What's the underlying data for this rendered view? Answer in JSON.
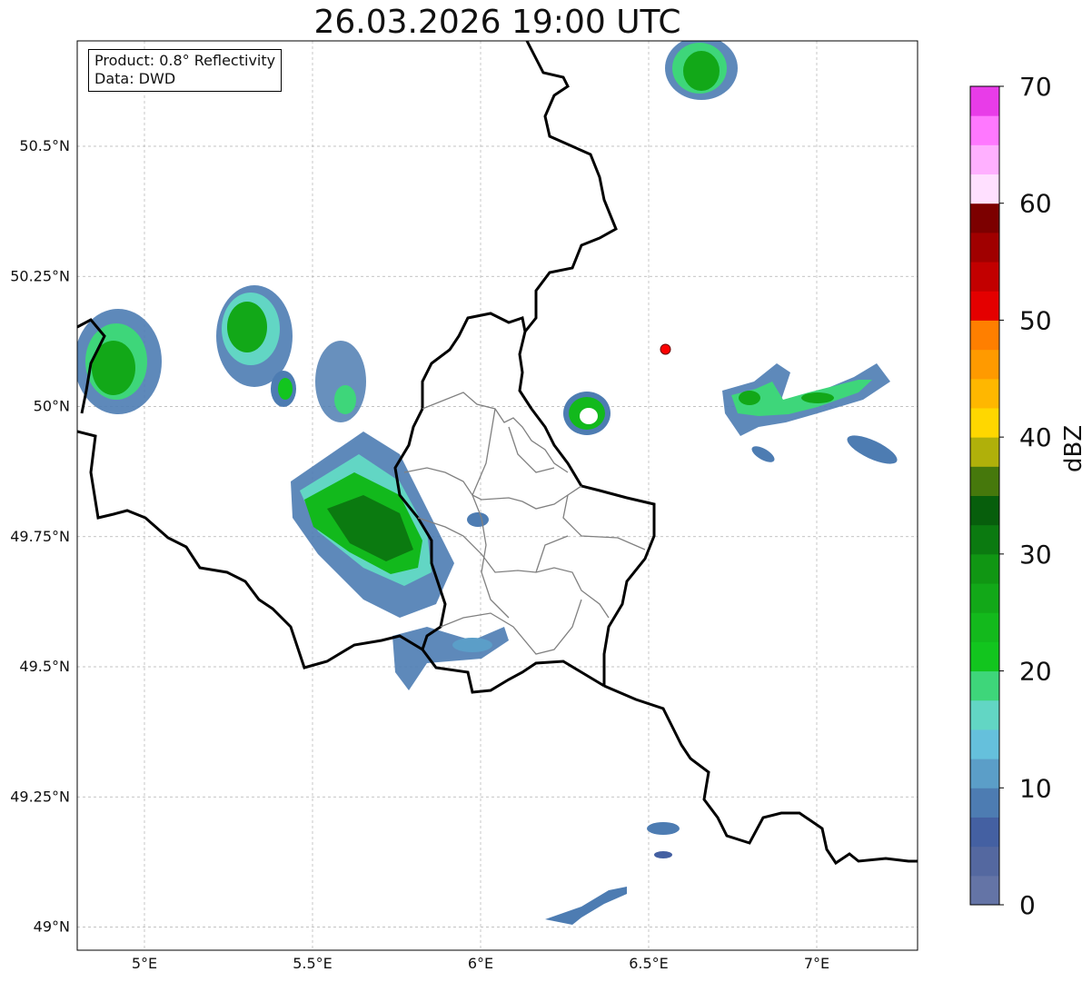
{
  "title": "26.03.2026 19:00 UTC",
  "info": {
    "product": "Product: 0.8° Reflectivity",
    "source": "Data: DWD"
  },
  "map": {
    "lon_range": [
      4.8,
      7.3
    ],
    "lat_range": [
      48.95,
      50.7
    ],
    "lat_ticks": [
      {
        "value": 50.5,
        "label": "50.5°N"
      },
      {
        "value": 50.25,
        "label": "50.25°N"
      },
      {
        "value": 50.0,
        "label": "50°N"
      },
      {
        "value": 49.75,
        "label": "49.75°N"
      },
      {
        "value": 49.5,
        "label": "49.5°N"
      },
      {
        "value": 49.25,
        "label": "49.25°N"
      },
      {
        "value": 49.0,
        "label": "49°N"
      }
    ],
    "lon_ticks": [
      {
        "value": 5.0,
        "label": "5°E"
      },
      {
        "value": 5.5,
        "label": "5.5°E"
      },
      {
        "value": 6.0,
        "label": "6°E"
      },
      {
        "value": 6.5,
        "label": "6.5°E"
      },
      {
        "value": 7.0,
        "label": "7°E"
      }
    ],
    "radar_site": {
      "lon": 6.55,
      "lat": 50.11,
      "color": "#ff0000"
    },
    "grid": true
  },
  "colorbar": {
    "label": "dBZ",
    "min": 0,
    "max": 70,
    "ticks": [
      "0",
      "10",
      "20",
      "30",
      "40",
      "50",
      "60",
      "70"
    ],
    "colors": [
      "#6474a6",
      "#5468a0",
      "#4460a2",
      "#4d7cb2",
      "#5b9ec8",
      "#65c0dc",
      "#62d6c4",
      "#3ed67a",
      "#12c51e",
      "#13b91c",
      "#12a818",
      "#109613",
      "#0b7a10",
      "#075e0c",
      "#46780c",
      "#b0b00a",
      "#ffd700",
      "#ffb700",
      "#ff9a00",
      "#ff7f00",
      "#e40000",
      "#c20000",
      "#a00000",
      "#7c0000",
      "#ffe0ff",
      "#ffb0ff",
      "#ff78ff",
      "#e83ce8"
    ]
  }
}
